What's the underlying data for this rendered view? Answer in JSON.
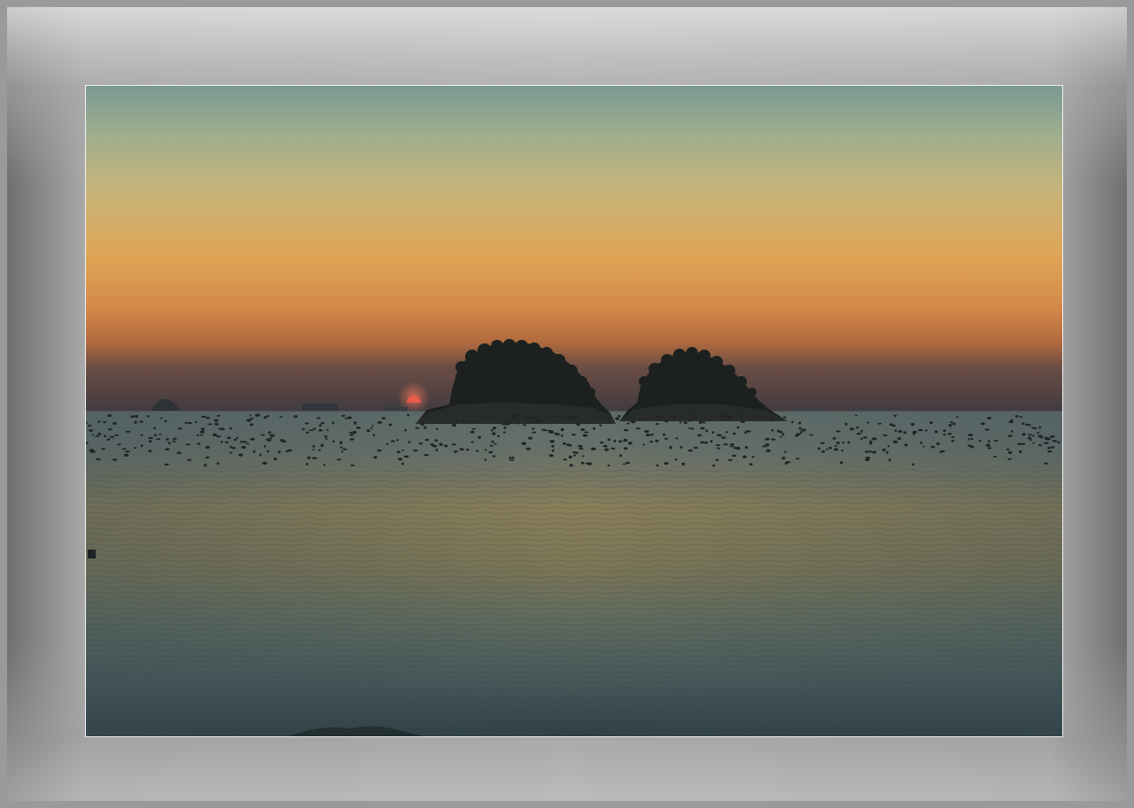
{
  "frame": {
    "border_color": "#9a9a9a",
    "mat_color": "#b0b0b0",
    "inner_rule_color": "#f2f2f2"
  },
  "photo": {
    "subject": "sunrise-over-sea-with-two-rocky-islets",
    "colors": {
      "sky_top": "#7f9a93",
      "sky_mid": "#c9b47c",
      "sky_glow": "#e0a55a",
      "sky_low": "#c97a3f",
      "haze": "#4a4040",
      "sun": "#e2564a",
      "island": "#1d2220",
      "sea_far": "#556766",
      "sea_warm": "#8c7d55",
      "sea_near": "#3e5356"
    }
  }
}
